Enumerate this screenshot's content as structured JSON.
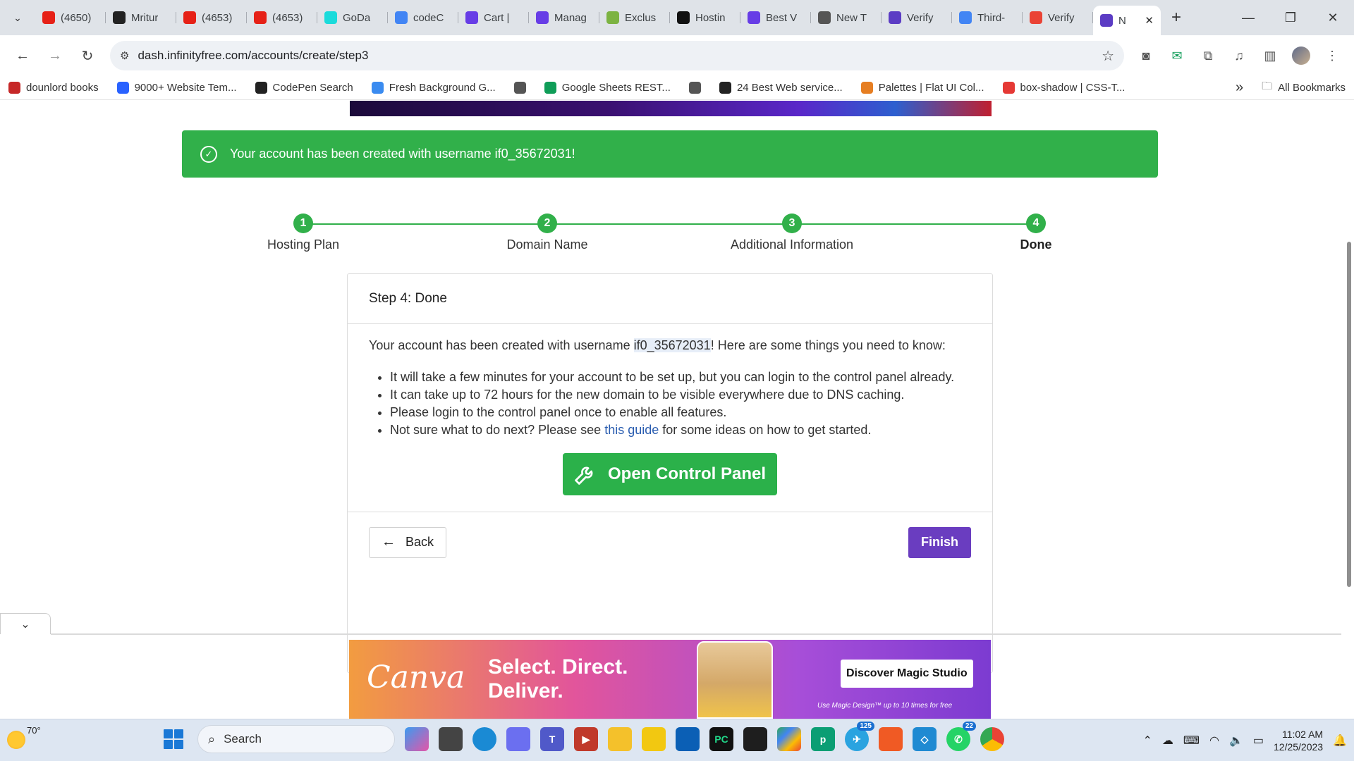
{
  "browser": {
    "tabs": [
      {
        "title": "(4650)",
        "icon": "youtube-icon",
        "color": "#e62117"
      },
      {
        "title": "Mritur",
        "icon": "github-icon",
        "color": "#222222"
      },
      {
        "title": "(4653)",
        "icon": "youtube-icon",
        "color": "#e62117"
      },
      {
        "title": "(4653)",
        "icon": "youtube-icon",
        "color": "#e62117"
      },
      {
        "title": "GoDa",
        "icon": "godaddy-icon",
        "color": "#1bdbdb"
      },
      {
        "title": "codeC",
        "icon": "google-icon",
        "color": "#4285f4"
      },
      {
        "title": "Cart |",
        "icon": "hostinger-icon",
        "color": "#673de6"
      },
      {
        "title": "Manag",
        "icon": "hostinger-icon",
        "color": "#673de6"
      },
      {
        "title": "Exclus",
        "icon": "exclusive-icon",
        "color": "#7cb342"
      },
      {
        "title": "Hostin",
        "icon": "hosting-icon",
        "color": "#111111"
      },
      {
        "title": "Best V",
        "icon": "hostinger-icon",
        "color": "#673de6"
      },
      {
        "title": "New T",
        "icon": "chrome-icon",
        "color": "#555555"
      },
      {
        "title": "Verify",
        "icon": "infinity-icon",
        "color": "#5b3cc4"
      },
      {
        "title": "Third-",
        "icon": "google-icon",
        "color": "#4285f4"
      },
      {
        "title": "Verify",
        "icon": "gmail-icon",
        "color": "#ea4335"
      },
      {
        "title": "N",
        "icon": "infinity-icon",
        "color": "#5b3cc4",
        "active": true
      }
    ],
    "url": "dash.infinityfree.com/accounts/create/step3",
    "bookmarks": [
      {
        "label": "dounlord books",
        "icon": "pd-icon",
        "color": "#c62828"
      },
      {
        "label": "9000+ Website Tem...",
        "icon": "n-icon",
        "color": "#2962ff"
      },
      {
        "label": "CodePen Search",
        "icon": "codepen-icon",
        "color": "#222222"
      },
      {
        "label": "Fresh Background G...",
        "icon": "gradient-icon",
        "color": "#3a8bf0"
      },
      {
        "label": "",
        "icon": "globe-icon",
        "color": "#555555"
      },
      {
        "label": "Google Sheets REST...",
        "icon": "sheets-icon",
        "color": "#0f9d58"
      },
      {
        "label": "",
        "icon": "globe-icon",
        "color": "#555555"
      },
      {
        "label": "24 Best Web service...",
        "icon": "wordpress-icon",
        "color": "#222222"
      },
      {
        "label": "Palettes | Flat UI Col...",
        "icon": "palette-icon",
        "color": "#e67e22"
      },
      {
        "label": "box-shadow | CSS-T...",
        "icon": "asterisk-icon",
        "color": "#e53935"
      }
    ],
    "more_bookmarks": "»",
    "all_bookmarks": "All Bookmarks"
  },
  "alert": {
    "message": "Your account has been created with username if0_35672031!"
  },
  "stepper": {
    "steps": [
      {
        "number": "1",
        "label": "Hosting Plan"
      },
      {
        "number": "2",
        "label": "Domain Name"
      },
      {
        "number": "3",
        "label": "Additional Information"
      },
      {
        "number": "4",
        "label": "Done"
      }
    ]
  },
  "card": {
    "title": "Step 4: Done",
    "intro_before": "Your account has been created with username ",
    "username": "if0_35672031",
    "intro_after": "! Here are some things you need to know:",
    "items": [
      "It will take a few minutes for your account to be set up, but you can login to the control panel already.",
      "It can take up to 72 hours for the new domain to be visible everywhere due to DNS caching.",
      "Please login to the control panel once to enable all features."
    ],
    "guide_before": "Not sure what to do next? Please see ",
    "guide_link": "this guide",
    "guide_after": " for some ideas on how to get started.",
    "control_panel_button": "Open Control Panel",
    "back_button": "Back",
    "finish_button": "Finish"
  },
  "ad": {
    "brand": "Canva",
    "tagline": "Select. Direct. Deliver.",
    "cta": "Discover Magic Studio",
    "fineprint": "Use Magic Design™ up to 10 times for free"
  },
  "taskbar": {
    "temperature": "70°",
    "search_placeholder": "Search",
    "time": "11:02 AM",
    "date": "12/25/2023",
    "telegram_badge": "125",
    "whatsapp_badge": "22"
  }
}
